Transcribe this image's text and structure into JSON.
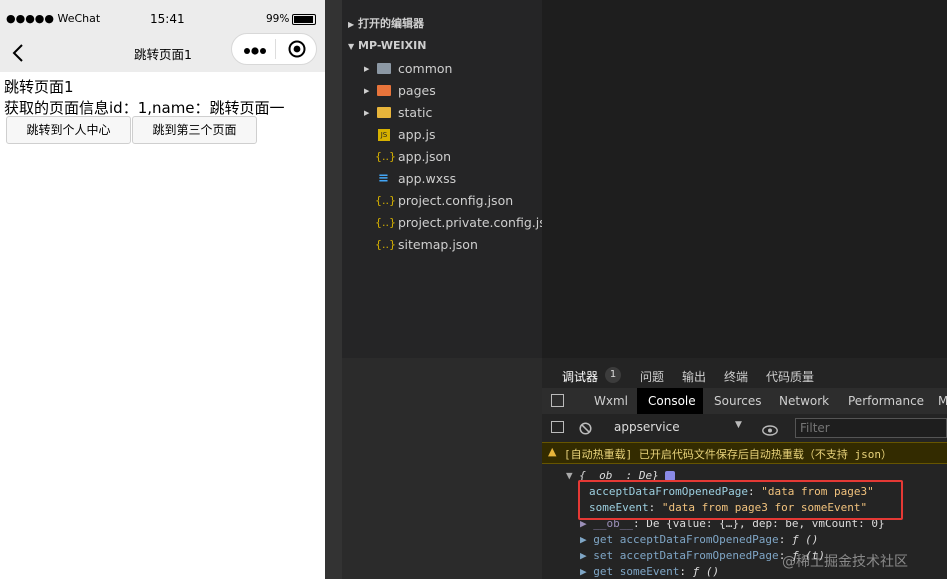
{
  "statusbar": {
    "signal": "●●●●● WeChat",
    "time": "15:41",
    "battery": "99%"
  },
  "navbar": {
    "title": "跳转页面1"
  },
  "page": {
    "heading": "跳转页面1",
    "info": "获取的页面信息id：1,name：跳转页面一",
    "button_user": "跳转到个人中心",
    "button_third": "跳到第三个页面"
  },
  "explorer": {
    "section_open": "打开的编辑器",
    "project": "MP-WEIXIN",
    "items": [
      {
        "label": "common",
        "icon": "folder-icon"
      },
      {
        "label": "pages",
        "icon": "pages-folder-icon"
      },
      {
        "label": "static",
        "icon": "folder-yellow-icon"
      },
      {
        "label": "app.js",
        "icon": "js-file-icon"
      },
      {
        "label": "app.json",
        "icon": "json-file-icon"
      },
      {
        "label": "app.wxss",
        "icon": "css-file-icon"
      },
      {
        "label": "project.config.json",
        "icon": "json-file-icon"
      },
      {
        "label": "project.private.config.js...",
        "icon": "json-file-icon"
      },
      {
        "label": "sitemap.json",
        "icon": "json-file-icon"
      }
    ]
  },
  "debugger": {
    "panel_tabs": [
      "调试器",
      "问题",
      "输出",
      "终端",
      "代码质量"
    ],
    "badge": "1",
    "devtools_tabs": [
      "Wxml",
      "Console",
      "Sources",
      "Network",
      "Performance",
      "M"
    ],
    "context": "appservice",
    "filter_placeholder": "Filter",
    "warning": "[自动热重载] 已开启代码文件保存后自动热重载（不支持 json）",
    "object_head": "{__ob__: De}",
    "lines": [
      {
        "key": "acceptDataFromOpenedPage",
        "value": "\"data from page3\""
      },
      {
        "key": "someEvent",
        "value": "\"data from page3 for someEvent\""
      },
      {
        "key": "▶ __ob__",
        "value": "De {value: {…}, dep: be, vmCount: 0}"
      },
      {
        "key": "▶ get acceptDataFromOpenedPage",
        "value": "ƒ ()"
      },
      {
        "key": "▶ set acceptDataFromOpenedPage",
        "value": "ƒ (t)"
      },
      {
        "key": "▶ get someEvent",
        "value": "ƒ ()"
      }
    ],
    "highlight_color": "#e53935"
  },
  "watermark": "@稀土掘金技术社区"
}
